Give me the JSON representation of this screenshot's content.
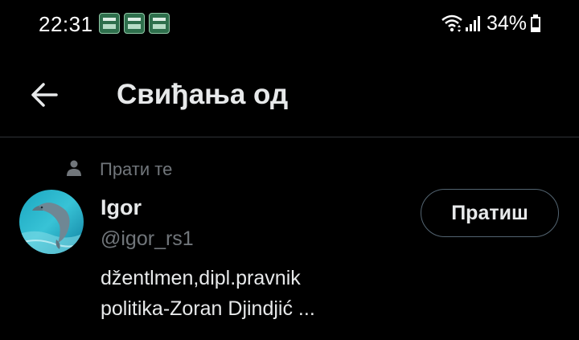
{
  "status_bar": {
    "time": "22:31",
    "notification_icons": [
      "igor-app-icon",
      "igor-app-icon",
      "igor-app-icon"
    ],
    "battery_percent_text": "34%",
    "battery_level": 0.34
  },
  "header": {
    "back_icon": "arrow-left-icon",
    "title": "Свиђања од"
  },
  "user": {
    "follows_you": "Прати те",
    "name": "Igor",
    "handle": "@igor_rs1",
    "bio": [
      "džentlmen,dipl.pravnik",
      "politika-Zoran Djindjić ..."
    ],
    "follow_button": "Пратиш",
    "avatar": "dolphin-avatar"
  },
  "colors": {
    "background": "#000000",
    "primary_text": "#e7e9ea",
    "secondary_text": "#71767b",
    "divider": "#2f3336",
    "button_border": "#536471"
  }
}
